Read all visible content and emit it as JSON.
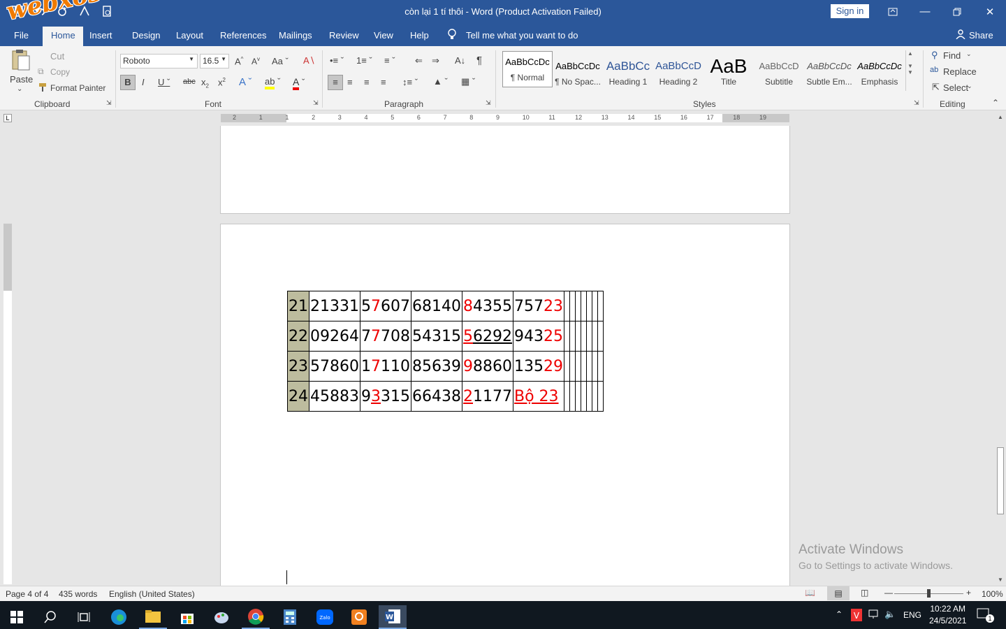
{
  "title_bar": {
    "document_title": "còn lại 1 tí thôi  -  Word (Product Activation Failed)",
    "sign_in": "Sign in",
    "watermark": "webxoso.net"
  },
  "menu": {
    "file": "File",
    "home": "Home",
    "insert": "Insert",
    "design": "Design",
    "layout": "Layout",
    "references": "References",
    "mailings": "Mailings",
    "review": "Review",
    "view": "View",
    "help": "Help",
    "tell_me": "Tell me what you want to do",
    "share": "Share"
  },
  "ribbon": {
    "clipboard": {
      "paste": "Paste",
      "cut": "Cut",
      "copy": "Copy",
      "format_painter": "Format Painter",
      "label": "Clipboard"
    },
    "font": {
      "font_name": "Roboto",
      "font_size": "16.5",
      "label": "Font"
    },
    "paragraph": {
      "label": "Paragraph"
    },
    "styles": {
      "label": "Styles",
      "items": [
        {
          "preview": "AaBbCcDc",
          "name": "¶ Normal"
        },
        {
          "preview": "AaBbCcDc",
          "name": "¶ No Spac..."
        },
        {
          "preview": "AaBbCc",
          "name": "Heading 1"
        },
        {
          "preview": "AaBbCcD",
          "name": "Heading 2"
        },
        {
          "preview": "AaB",
          "name": "Title"
        },
        {
          "preview": "AaBbCcD",
          "name": "Subtitle"
        },
        {
          "preview": "AaBbCcDc",
          "name": "Subtle Em..."
        },
        {
          "preview": "AaBbCcDc",
          "name": "Emphasis"
        }
      ]
    },
    "editing": {
      "find": "Find",
      "replace": "Replace",
      "select": "Select",
      "label": "Editing"
    }
  },
  "ruler_numbers": [
    "2",
    "1",
    "1",
    "2",
    "3",
    "4",
    "5",
    "6",
    "7",
    "8",
    "9",
    "10",
    "11",
    "12",
    "13",
    "14",
    "15",
    "16",
    "17",
    "18",
    "19"
  ],
  "table": {
    "rows": [
      {
        "day": "21",
        "cells": [
          [
            {
              "t": "21331"
            }
          ],
          [
            {
              "t": "5"
            },
            {
              "t": "7",
              "c": "red"
            },
            {
              "t": "607"
            }
          ],
          [
            {
              "t": "68140"
            }
          ],
          [
            {
              "t": "8",
              "c": "red"
            },
            {
              "t": "4355"
            }
          ],
          [
            {
              "t": "757"
            },
            {
              "t": "23",
              "c": "red"
            }
          ]
        ]
      },
      {
        "day": "22",
        "cells": [
          [
            {
              "t": "09264"
            }
          ],
          [
            {
              "t": "7"
            },
            {
              "t": "7",
              "c": "red"
            },
            {
              "t": "708"
            }
          ],
          [
            {
              "t": "54315"
            }
          ],
          [
            {
              "t": "5",
              "c": "red ul"
            },
            {
              "t": "6292",
              "c": "ul"
            }
          ],
          [
            {
              "t": "943"
            },
            {
              "t": "25",
              "c": "red"
            }
          ]
        ]
      },
      {
        "day": "23",
        "cells": [
          [
            {
              "t": "57860"
            }
          ],
          [
            {
              "t": "1"
            },
            {
              "t": "7",
              "c": "red"
            },
            {
              "t": "110"
            }
          ],
          [
            {
              "t": "85639"
            }
          ],
          [
            {
              "t": "9",
              "c": "red"
            },
            {
              "t": "8860"
            }
          ],
          [
            {
              "t": "135"
            },
            {
              "t": "29",
              "c": "red"
            }
          ]
        ]
      },
      {
        "day": "24",
        "cells": [
          [
            {
              "t": "45883"
            }
          ],
          [
            {
              "t": "9"
            },
            {
              "t": "3",
              "c": "red ul"
            },
            {
              "t": "315"
            }
          ],
          [
            {
              "t": "66438"
            }
          ],
          [
            {
              "t": "2",
              "c": "red ul"
            },
            {
              "t": "1177"
            }
          ],
          [
            {
              "t": "Bộ 23 ",
              "c": "red ul"
            }
          ]
        ]
      }
    ],
    "empty_cols": 7
  },
  "activation": {
    "line1": "Activate Windows",
    "line2": "Go to Settings to activate Windows."
  },
  "status": {
    "page": "Page 4 of 4",
    "words": "435 words",
    "language": "English (United States)",
    "zoom": "100%"
  },
  "taskbar": {
    "lang": "ENG",
    "time": "10:22 AM",
    "date": "24/5/2021",
    "notification_count": "1"
  }
}
